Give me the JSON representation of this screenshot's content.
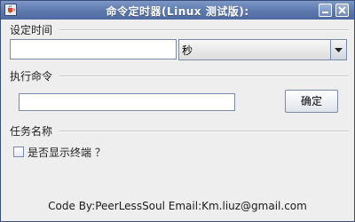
{
  "window": {
    "title": "命令定时器(Linux 测试版):"
  },
  "timer_group": {
    "label": "设定时间",
    "time_value": "",
    "unit_selected": "秒"
  },
  "command_group": {
    "label": "执行命令",
    "command_value": "",
    "confirm_label": "确定"
  },
  "task_group": {
    "label": "任务名称",
    "show_terminal_label": "是否显示终端 ？",
    "show_terminal_checked": false
  },
  "footer": {
    "text": "Code By:PeerLessSoul  Email:Km.liuz@gmail.com"
  }
}
